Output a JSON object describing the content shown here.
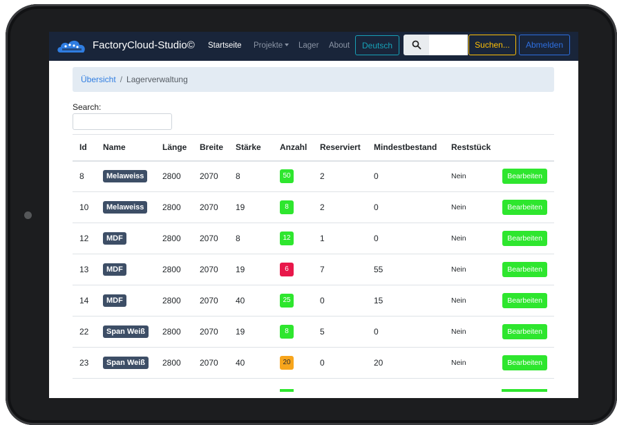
{
  "navbar": {
    "brand": "FactoryCloud-Studio©",
    "links": [
      {
        "label": "Startseite",
        "active": true
      },
      {
        "label": "Projekte",
        "dropdown": true
      },
      {
        "label": "Lager"
      },
      {
        "label": "About"
      }
    ],
    "language_button": "Deutsch",
    "search_placeholder": "",
    "search_button": "Suchen...",
    "logout_button": "Abmelden"
  },
  "breadcrumb": {
    "link": "Übersicht",
    "separator": "/",
    "current": "Lagerverwaltung"
  },
  "table_search": {
    "label": "Search:",
    "value": ""
  },
  "table": {
    "columns": [
      "Id",
      "Name",
      "Länge",
      "Breite",
      "Stärke",
      "Anzahl",
      "Reserviert",
      "Mindestbestand",
      "Reststück",
      ""
    ],
    "rows": [
      {
        "id": "8",
        "name": "Melaweiss",
        "laenge": "2800",
        "breite": "2070",
        "staerke": "8",
        "anzahl": "50",
        "anzahl_status": "green",
        "reserviert": "2",
        "mindestbestand": "0",
        "reststueck": "Nein",
        "action": "Bearbeiten"
      },
      {
        "id": "10",
        "name": "Melaweiss",
        "laenge": "2800",
        "breite": "2070",
        "staerke": "19",
        "anzahl": "8",
        "anzahl_status": "green",
        "reserviert": "2",
        "mindestbestand": "0",
        "reststueck": "Nein",
        "action": "Bearbeiten"
      },
      {
        "id": "12",
        "name": "MDF",
        "laenge": "2800",
        "breite": "2070",
        "staerke": "8",
        "anzahl": "12",
        "anzahl_status": "green",
        "reserviert": "1",
        "mindestbestand": "0",
        "reststueck": "Nein",
        "action": "Bearbeiten"
      },
      {
        "id": "13",
        "name": "MDF",
        "laenge": "2800",
        "breite": "2070",
        "staerke": "19",
        "anzahl": "6",
        "anzahl_status": "red",
        "reserviert": "7",
        "mindestbestand": "55",
        "reststueck": "Nein",
        "action": "Bearbeiten"
      },
      {
        "id": "14",
        "name": "MDF",
        "laenge": "2800",
        "breite": "2070",
        "staerke": "40",
        "anzahl": "25",
        "anzahl_status": "green",
        "reserviert": "0",
        "mindestbestand": "15",
        "reststueck": "Nein",
        "action": "Bearbeiten"
      },
      {
        "id": "22",
        "name": "Span Weiß",
        "laenge": "2800",
        "breite": "2070",
        "staerke": "19",
        "anzahl": "8",
        "anzahl_status": "green",
        "reserviert": "5",
        "mindestbestand": "0",
        "reststueck": "Nein",
        "action": "Bearbeiten"
      },
      {
        "id": "23",
        "name": "Span Weiß",
        "laenge": "2800",
        "breite": "2070",
        "staerke": "40",
        "anzahl": "20",
        "anzahl_status": "orange",
        "reserviert": "0",
        "mindestbestand": "20",
        "reststueck": "Nein",
        "action": "Bearbeiten"
      }
    ]
  },
  "colors": {
    "navbar_bg": "#19253a",
    "status_green": "#2ee62e",
    "status_red": "#e8174a",
    "status_orange": "#f7a51c",
    "name_badge": "#3d4e66",
    "language_outline": "#17a2b8",
    "search_outline": "#ffc107",
    "logout_outline": "#2e6fe0"
  },
  "icons": {
    "brand": "cloud-logo-icon",
    "search": "search-icon",
    "dropdown": "caret-down-icon"
  }
}
